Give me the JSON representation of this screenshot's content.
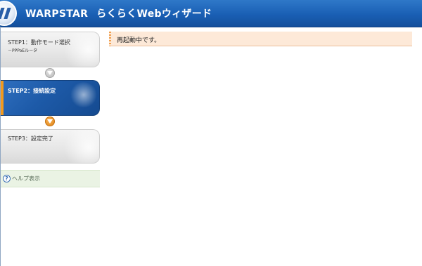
{
  "header": {
    "brand": "WARPSTAR",
    "subtitle": "らくらくWebウィザード"
  },
  "steps": [
    {
      "label": "STEP1：動作モード選択",
      "sub": "－PPPoEルータ",
      "state": "done"
    },
    {
      "label": "STEP2：接続設定",
      "state": "active"
    },
    {
      "label": "STEP3：設定完了",
      "state": "pending"
    }
  ],
  "help": {
    "label": "ヘルプ表示",
    "icon_glyph": "?"
  },
  "status": {
    "message": "再起動中です。"
  },
  "colors": {
    "header_blue": "#1a5fb4",
    "active_step_blue": "#1d5aa8",
    "active_marker_orange": "#f29a1e",
    "status_background": "#fde9d8",
    "help_background": "#eaf3e4"
  },
  "icons": {
    "logo": "warpstar-logo-icon",
    "step_arrow": "chevron-down-icon",
    "help": "help-icon"
  }
}
